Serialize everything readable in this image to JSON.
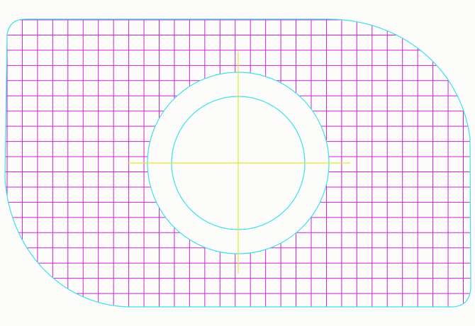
{
  "drawing": {
    "type": "cad-hatched-plate-with-hole",
    "colors": {
      "background": "#fcfdfb",
      "outline": "#3ee0ea",
      "hatch": "#d21fd6",
      "centerline": "#e6e632"
    },
    "hatch_pattern": "orthogonal grid",
    "features": [
      "plate-outline",
      "hatch-grid",
      "outer-ring",
      "inner-ring",
      "horizontal-centerline",
      "vertical-centerline"
    ]
  }
}
